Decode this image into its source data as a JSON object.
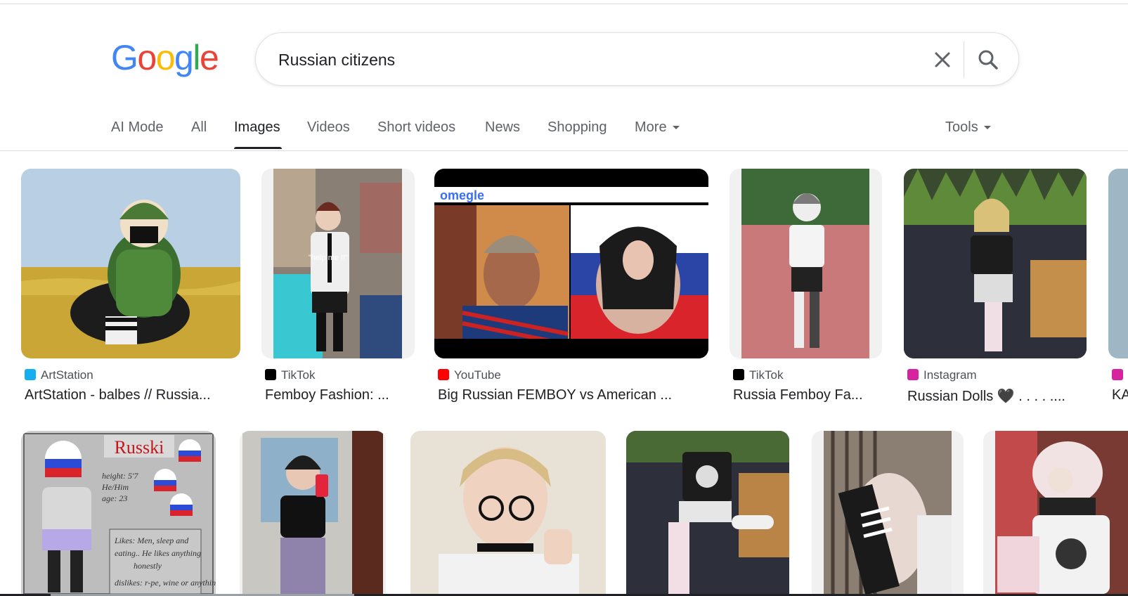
{
  "logo": {
    "letters": [
      "G",
      "o",
      "o",
      "g",
      "l",
      "e"
    ],
    "colors": [
      "#4285F4",
      "#EA4335",
      "#FBBC05",
      "#4285F4",
      "#34A853",
      "#EA4335"
    ]
  },
  "search": {
    "query": "Russian citizens"
  },
  "tabs": [
    {
      "label": "AI Mode",
      "active": false
    },
    {
      "label": "All",
      "active": false
    },
    {
      "label": "Images",
      "active": true
    },
    {
      "label": "Videos",
      "active": false
    },
    {
      "label": "Short videos",
      "active": false
    },
    {
      "label": "News",
      "active": false
    },
    {
      "label": "Shopping",
      "active": false
    },
    {
      "label": "More",
      "active": false
    }
  ],
  "tools_label": "Tools",
  "results_row1": [
    {
      "source": "ArtStation",
      "source_icon": "artstation-icon",
      "title": "ArtStation - balbes // Russia..."
    },
    {
      "source": "TikTok",
      "source_icon": "tiktok-icon",
      "title": "Femboy Fashion: ..."
    },
    {
      "source": "YouTube",
      "source_icon": "youtube-icon",
      "title": "Big Russian FEMBOY vs American ...",
      "overlay_text": "omegle"
    },
    {
      "source": "TikTok",
      "source_icon": "tiktok-icon",
      "title": "Russia Femboy Fa..."
    },
    {
      "source": "Instagram",
      "source_icon": "instagram-icon",
      "title": "Russian Dolls 🖤 . . . . ...."
    },
    {
      "source": "",
      "source_icon": "instagram-icon",
      "title": "KA"
    }
  ],
  "results_row2_overlay": {
    "heading": "Russki",
    "lines": [
      "height: 5'7",
      "He/Him",
      "age: 23",
      "Likes: Men, sleep and",
      "eating.. He likes anything",
      "honestly",
      "dislikes: r-pe, wine or anything"
    ]
  }
}
